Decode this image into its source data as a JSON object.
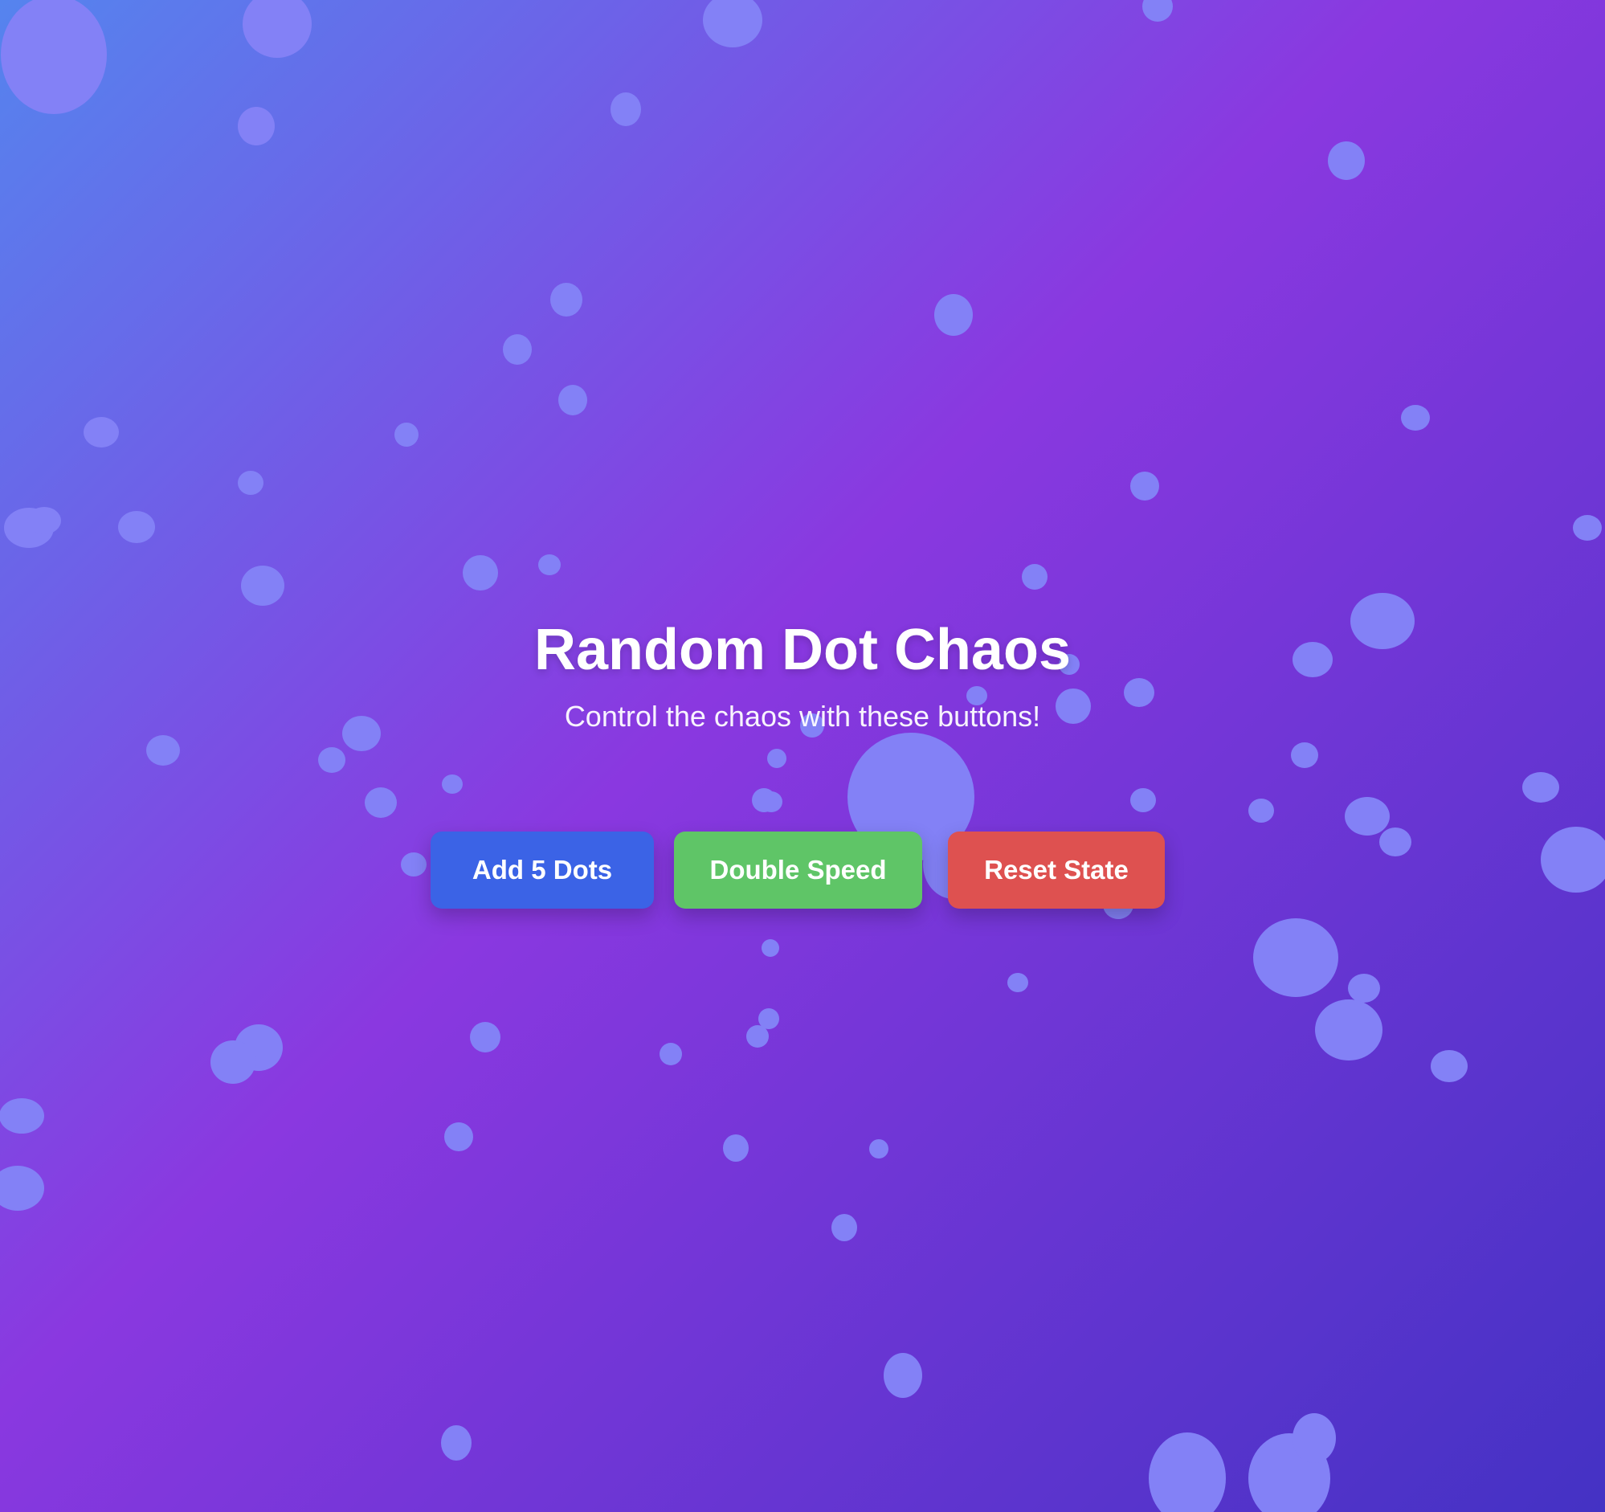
{
  "page": {
    "title": "Random Dot Chaos",
    "subtitle": "Control the chaos with these buttons!"
  },
  "buttons": {
    "add_dots_label": "Add 5 Dots",
    "double_speed_label": "Double Speed",
    "reset_label": "Reset State"
  },
  "colors": {
    "background_start": "#5584ee",
    "background_mid": "#8a38e0",
    "background_end": "#4432c4",
    "dot": "#8381f6",
    "add_dots_button": "#3b63e6",
    "double_speed_button": "#5fc567",
    "reset_button": "#de5150",
    "text": "#ffffff"
  }
}
